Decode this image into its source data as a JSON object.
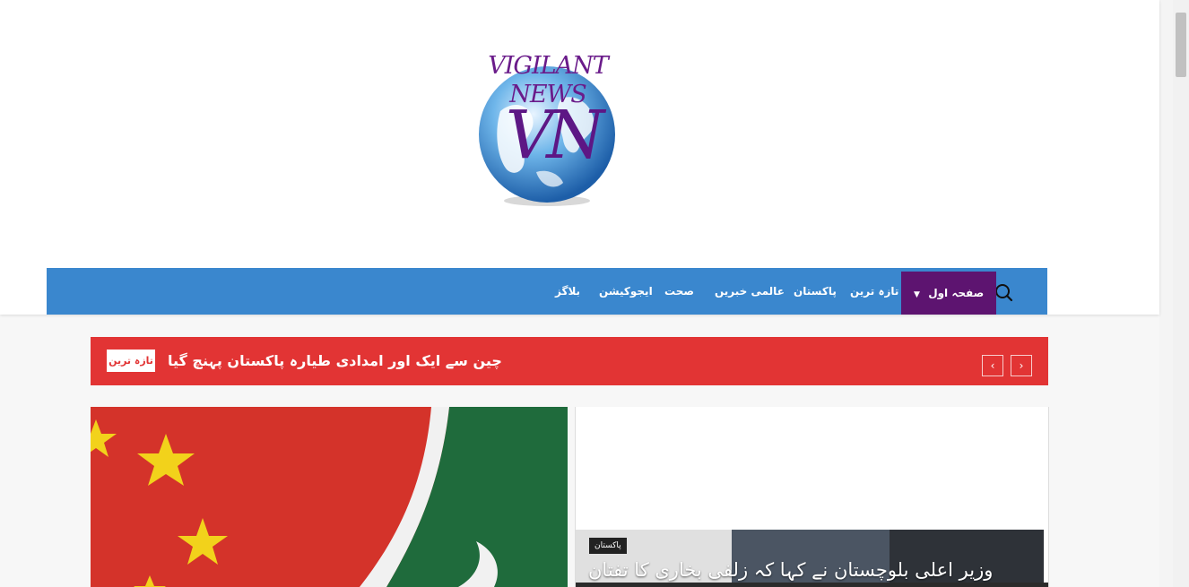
{
  "logo": {
    "line1": "VIGILANT",
    "line2": "NEWS",
    "monogram": "VN"
  },
  "nav": {
    "home_label": "صفحہ اول",
    "items": [
      "تازہ ترین",
      "پاکستان",
      "عالمی خبریں",
      "صحت",
      "ایجوکیشن",
      "بلاگز"
    ],
    "search_icon": "search-icon",
    "active_color": "#5d1470",
    "bar_color": "#3a87ce"
  },
  "ticker": {
    "badge": "تازہ ترین",
    "headline": "چین سے ایک اور امدادی طیارہ پاکستان پہنچ گیا",
    "prev": "‹",
    "next": "›",
    "color": "#e23434"
  },
  "featured": {
    "category": "پاکستان",
    "title": "وزیر اعلی بلوچستان نے کہا کہ زلفی بخاری کا تفتان"
  }
}
